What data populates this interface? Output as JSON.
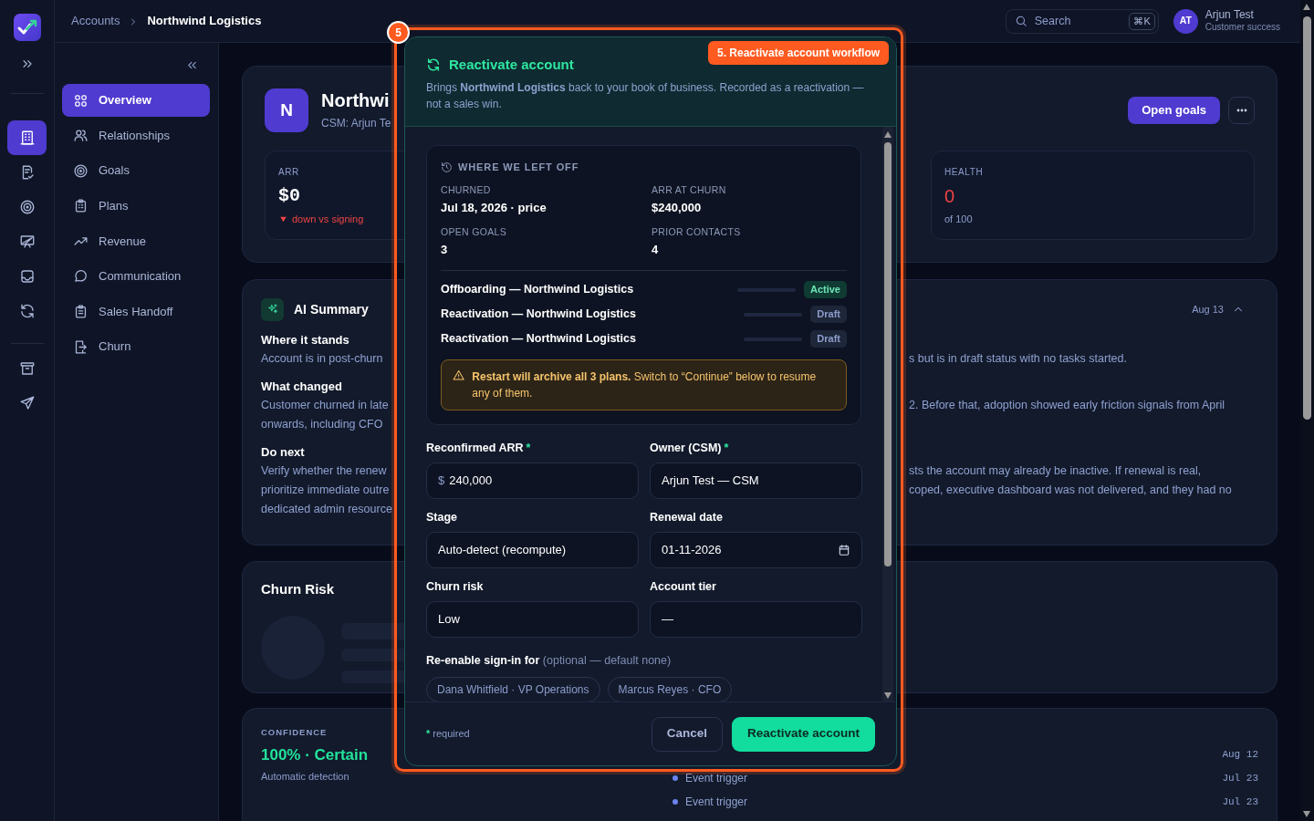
{
  "header": {
    "breadcrumb": [
      "Accounts",
      "Northwind Logistics"
    ],
    "search": {
      "placeholder": "Search",
      "shortcut": "⌘K"
    },
    "user": {
      "initials": "AT",
      "name": "Arjun Test",
      "role": "Customer success"
    }
  },
  "rail": {
    "primary": [
      {
        "kind": "building",
        "selected": true
      },
      {
        "kind": "checklist",
        "selected": false
      },
      {
        "kind": "target",
        "selected": false
      },
      {
        "kind": "board",
        "selected": false
      },
      {
        "kind": "inbox",
        "selected": false
      },
      {
        "kind": "sync",
        "selected": false
      }
    ],
    "secondary": [
      {
        "kind": "archive",
        "selected": false
      },
      {
        "kind": "send",
        "selected": false
      }
    ]
  },
  "sidebar": {
    "items": [
      {
        "label": "Overview",
        "kind": "grid",
        "selected": true
      },
      {
        "label": "Relationships",
        "kind": "users",
        "selected": false
      },
      {
        "label": "Goals",
        "kind": "target",
        "selected": false
      },
      {
        "label": "Plans",
        "kind": "clipboard",
        "selected": false
      },
      {
        "label": "Revenue",
        "kind": "trend",
        "selected": false
      },
      {
        "label": "Communication",
        "kind": "chat",
        "selected": false
      },
      {
        "label": "Sales Handoff",
        "kind": "clipboard2",
        "selected": false
      },
      {
        "label": "Churn",
        "kind": "exit",
        "selected": false
      }
    ]
  },
  "account": {
    "initial": "N",
    "name": "Northwi",
    "csm": "CSM: Arjun Te",
    "primary_button": "Open goals",
    "stats": [
      {
        "label": "ARR",
        "value": "$0",
        "note": "down vs signing",
        "down": true,
        "alert": false
      },
      {
        "label": "HEALTH",
        "value": "0",
        "note": "of 100",
        "down": false,
        "alert": true
      }
    ]
  },
  "ai_summary": {
    "title": "AI Summary",
    "date": "Aug 13",
    "expanded": true,
    "sections": [
      {
        "heading": "Where it stands",
        "lines": [
          {
            "left": "Account is in post-churn",
            "right": "s but is in draft status with no tasks started."
          }
        ]
      },
      {
        "heading": "What changed",
        "lines": [
          {
            "left": "Customer churned in late",
            "right": "2. Before that, adoption showed early friction signals from April"
          },
          {
            "left": "onwards, including CFO"
          }
        ]
      },
      {
        "heading": "Do next",
        "lines": [
          {
            "left": "Verify whether the renew",
            "right": "sts the account may already be inactive. If renewal is real,"
          },
          {
            "left": "prioritize immediate outre",
            "right": "coped, executive dashboard was not delivered, and they had no"
          },
          {
            "left": "dedicated admin resource"
          }
        ]
      }
    ]
  },
  "churn_risk": {
    "title": "Churn Risk",
    "loading": true
  },
  "confidence": {
    "label": "CONFIDENCE",
    "value": "100% · Certain",
    "source": "Automatic detection",
    "events": [
      {
        "date": "Aug 12"
      },
      {
        "label": "Event trigger",
        "date": "Jul 23"
      },
      {
        "label": "Event trigger",
        "date": "Jul 23"
      }
    ]
  },
  "modal": {
    "title": "Reactivate account",
    "description": "Brings **Northwind Logistics** back to your book of business. Recorded as a reactivation — not a sales win.",
    "required_mark": "*",
    "summary": {
      "title": "WHERE WE LEFT OFF",
      "facts": [
        {
          "label": "CHURNED",
          "value": "Jul 18, 2026 · price"
        },
        {
          "label": "ARR AT CHURN",
          "value": "$240,000"
        },
        {
          "label": "OPEN GOALS",
          "value": "3"
        },
        {
          "label": "PRIOR CONTACTS",
          "value": "4"
        }
      ],
      "plans": [
        {
          "name": "Offboarding — Northwind Logistics",
          "level": 0,
          "status": "Active",
          "active": true
        },
        {
          "name": "Reactivation — Northwind Logistics",
          "level": 0,
          "status": "Draft",
          "active": false
        },
        {
          "name": "Reactivation — Northwind Logistics",
          "level": 0,
          "status": "Draft",
          "active": false
        }
      ],
      "warning": "**Restart will archive all 3 plans.** Switch to “Continue” below to resume any of them."
    },
    "fields": [
      {
        "label": "Reconfirmed ARR",
        "required": true,
        "kind": "money",
        "prefix": "$",
        "value": "240,000"
      },
      {
        "label": "Owner (CSM)",
        "required": true,
        "kind": "select",
        "value": "Arjun Test — CSM"
      },
      {
        "label": "Stage",
        "required": false,
        "kind": "select",
        "value": "Auto-detect (recompute)"
      },
      {
        "label": "Renewal date",
        "required": false,
        "kind": "date",
        "value": "01-11-2026"
      },
      {
        "label": "Churn risk",
        "required": false,
        "kind": "select",
        "value": "Low"
      },
      {
        "label": "Account tier",
        "required": false,
        "kind": "select",
        "value": "—"
      }
    ],
    "signin": {
      "label": "Re-enable sign-in for",
      "hint": "(optional — default none)",
      "contacts": [
        {
          "label": "Dana Whitfield · VP Operations",
          "selected": false
        },
        {
          "label": "Marcus Reyes · CFO",
          "selected": false
        }
      ]
    },
    "footer": {
      "note": "required",
      "cancel": "Cancel",
      "confirm": "Reactivate account"
    }
  },
  "annotation": {
    "number": "5",
    "label": "5. Reactivate account workflow"
  }
}
